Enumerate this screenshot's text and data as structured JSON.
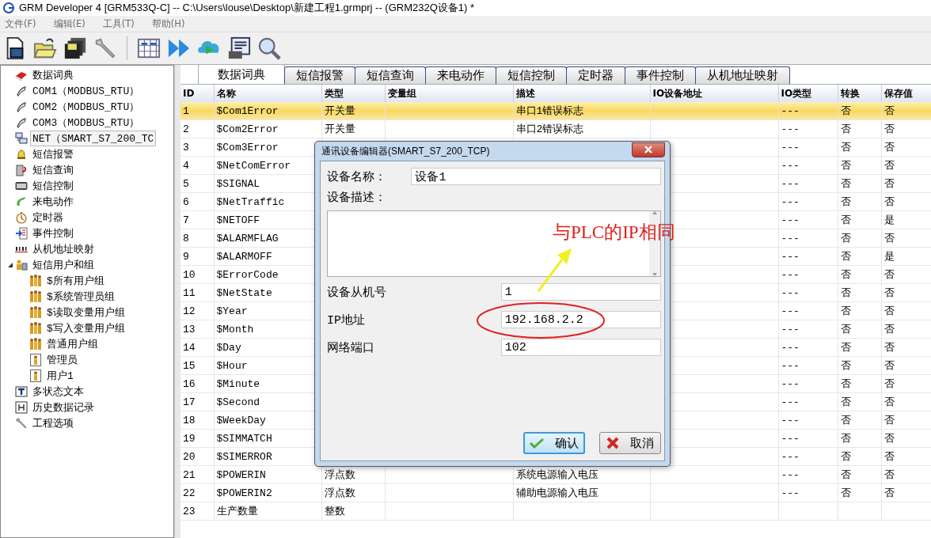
{
  "window": {
    "title": "GRM Developer 4 [GRM533Q-C]  -- C:\\Users\\louse\\Desktop\\新建工程1.grmprj -- (GRM232Q设备1) *"
  },
  "menu": [
    "文件(F)",
    "编辑(E)",
    "工具(T)",
    "帮助(H)"
  ],
  "tree": [
    {
      "label": "数据词典",
      "selected": false
    },
    {
      "label": "COM1（MODBUS_RTU）",
      "selected": false
    },
    {
      "label": "COM2（MODBUS_RTU）",
      "selected": false
    },
    {
      "label": "COM3（MODBUS_RTU）",
      "selected": false
    },
    {
      "label": "NET（SMART_S7_200_TC",
      "selected": true
    },
    {
      "label": "短信报警",
      "selected": false
    },
    {
      "label": "短信查询",
      "selected": false
    },
    {
      "label": "短信控制",
      "selected": false
    },
    {
      "label": "来电动作",
      "selected": false
    },
    {
      "label": "定时器",
      "selected": false
    },
    {
      "label": "事件控制",
      "selected": false
    },
    {
      "label": "从机地址映射",
      "selected": false
    },
    {
      "label": "短信用户和组",
      "selected": false,
      "expanded": true,
      "children": [
        {
          "label": "$所有用户组",
          "selected": false,
          "kind": "group"
        },
        {
          "label": "$系统管理员组",
          "selected": false,
          "kind": "group"
        },
        {
          "label": "$读取变量用户组",
          "selected": false,
          "kind": "group"
        },
        {
          "label": "$写入变量用户组",
          "selected": false,
          "kind": "group"
        },
        {
          "label": "普通用户组",
          "selected": false,
          "kind": "group"
        },
        {
          "label": "管理员",
          "selected": false,
          "kind": "user"
        },
        {
          "label": "用户1",
          "selected": false,
          "kind": "user"
        }
      ]
    },
    {
      "label": "多状态文本",
      "selected": false
    },
    {
      "label": "历史数据记录",
      "selected": false
    },
    {
      "label": "工程选项",
      "selected": false
    }
  ],
  "tabs": [
    {
      "label": "数据词典",
      "selected": true
    },
    {
      "label": "短信报警",
      "selected": false
    },
    {
      "label": "短信查询",
      "selected": false
    },
    {
      "label": "来电动作",
      "selected": false
    },
    {
      "label": "短信控制",
      "selected": false
    },
    {
      "label": "定时器",
      "selected": false
    },
    {
      "label": "事件控制",
      "selected": false
    },
    {
      "label": "从机地址映射",
      "selected": false
    }
  ],
  "table": {
    "columns": [
      "ID",
      "名称",
      "类型",
      "变量组",
      "描述",
      "IO设备地址",
      "IO类型",
      "转换",
      "保存值"
    ],
    "rows": [
      {
        "id": "1",
        "name": "$Com1Error",
        "type": "开关量",
        "description": "串口1错误标志",
        "io_type": "---",
        "convert": "否",
        "save": "否",
        "selected": true
      },
      {
        "id": "2",
        "name": "$Com2Error",
        "type": "开关量",
        "description": "串口2错误标志",
        "io_type": "---",
        "convert": "否",
        "save": "否",
        "selected": false
      },
      {
        "id": "3",
        "name": "$Com3Error",
        "io_type": "---",
        "convert": "否",
        "save": "否",
        "selected": false
      },
      {
        "id": "4",
        "name": "$NetComError",
        "io_type": "---",
        "convert": "否",
        "save": "否",
        "selected": false
      },
      {
        "id": "5",
        "name": "$SIGNAL",
        "io_type": "---",
        "convert": "否",
        "save": "否",
        "selected": false
      },
      {
        "id": "6",
        "name": "$NetTraffic",
        "io_type": "---",
        "convert": "否",
        "save": "否",
        "selected": false
      },
      {
        "id": "7",
        "name": "$NETOFF",
        "io_type": "---",
        "convert": "否",
        "save": "是",
        "selected": false
      },
      {
        "id": "8",
        "name": "$ALARMFLAG",
        "io_type": "---",
        "convert": "否",
        "save": "否",
        "selected": false
      },
      {
        "id": "9",
        "name": "$ALARMOFF",
        "io_type": "---",
        "convert": "否",
        "save": "是",
        "selected": false
      },
      {
        "id": "10",
        "name": "$ErrorCode",
        "io_type": "---",
        "convert": "否",
        "save": "否",
        "selected": false
      },
      {
        "id": "11",
        "name": "$NetState",
        "io_type": "---",
        "convert": "否",
        "save": "否",
        "selected": false
      },
      {
        "id": "12",
        "name": "$Year",
        "io_type": "---",
        "convert": "否",
        "save": "否",
        "selected": false
      },
      {
        "id": "13",
        "name": "$Month",
        "io_type": "---",
        "convert": "否",
        "save": "否",
        "selected": false
      },
      {
        "id": "14",
        "name": "$Day",
        "io_type": "---",
        "convert": "否",
        "save": "否",
        "selected": false
      },
      {
        "id": "15",
        "name": "$Hour",
        "io_type": "---",
        "convert": "否",
        "save": "否",
        "selected": false
      },
      {
        "id": "16",
        "name": "$Minute",
        "io_type": "---",
        "convert": "否",
        "save": "否",
        "selected": false
      },
      {
        "id": "17",
        "name": "$Second",
        "io_type": "---",
        "convert": "否",
        "save": "否",
        "selected": false
      },
      {
        "id": "18",
        "name": "$WeekDay",
        "io_type": "---",
        "convert": "否",
        "save": "否",
        "selected": false
      },
      {
        "id": "19",
        "name": "$SIMMATCH",
        "io_type": "---",
        "convert": "否",
        "save": "否",
        "selected": false
      },
      {
        "id": "20",
        "name": "$SIMERROR",
        "io_type": "---",
        "convert": "否",
        "save": "否",
        "selected": false
      },
      {
        "id": "21",
        "name": "$POWERIN",
        "type": "浮点数",
        "description": "系统电源输入电压",
        "io_type": "---",
        "convert": "否",
        "save": "否",
        "selected": false
      },
      {
        "id": "22",
        "name": "$POWERIN2",
        "type": "浮点数",
        "description": "辅助电源输入电压",
        "io_type": "---",
        "convert": "否",
        "save": "否",
        "selected": false
      },
      {
        "id": "23",
        "name": "生产数量",
        "type": "整数",
        "selected": false
      }
    ]
  },
  "dialog": {
    "title": "通讯设备编辑器(SMART_S7_200_TCP)",
    "fields": [
      {
        "kind": "inline",
        "label": "设备名称：",
        "value": "设备1"
      },
      {
        "kind": "textarea",
        "label": "设备描述："
      },
      {
        "kind": "row",
        "label": "设备从机号",
        "value": "1"
      },
      {
        "kind": "row",
        "label": "IP地址",
        "value": "192.168.2.2"
      },
      {
        "kind": "row",
        "label": "网络端口",
        "value": "102"
      }
    ],
    "buttons": [
      {
        "kind": "ok",
        "label": "确认"
      },
      {
        "kind": "cancel",
        "label": "取消"
      }
    ]
  },
  "annotation": {
    "text": "与PLC的IP相同"
  }
}
